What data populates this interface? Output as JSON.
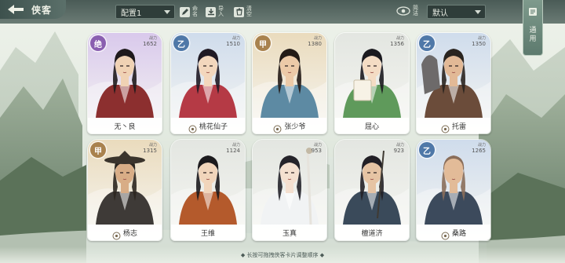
{
  "header": {
    "title": "侠客",
    "preset_value": "配置1",
    "sort_value": "默认",
    "tools": [
      {
        "label": "命名",
        "icon": "pencil-icon"
      },
      {
        "label": "导入",
        "icon": "import-icon"
      },
      {
        "label": "清空",
        "icon": "trash-icon"
      }
    ],
    "view_label": "简洁",
    "side_tab_label": "通用"
  },
  "cards": [
    {
      "name": "无丶良",
      "rank": "绝",
      "power_label": "战力",
      "power": "1652",
      "theme": "purple",
      "badge_color": "#8a5fb0"
    },
    {
      "name": "桃花仙子",
      "rank": "乙",
      "power_label": "战力",
      "power": "1510",
      "theme": "blue",
      "badge_color": "#4f78a8",
      "school_icon": "lotus-icon"
    },
    {
      "name": "张少爷",
      "rank": "甲",
      "power_label": "战力",
      "power": "1380",
      "theme": "gold",
      "badge_color": "#a9824e",
      "school_icon": "sword-icon"
    },
    {
      "name": "屈心",
      "rank": "",
      "power_label": "战力",
      "power": "1356",
      "theme": "grey",
      "badge_color": ""
    },
    {
      "name": "托雷",
      "rank": "乙",
      "power_label": "战力",
      "power": "1350",
      "theme": "blue",
      "badge_color": "#4f78a8",
      "school_icon": "wolf-icon"
    },
    {
      "name": "杨志",
      "rank": "甲",
      "power_label": "战力",
      "power": "1315",
      "theme": "gold",
      "badge_color": "#a9824e",
      "school_icon": "gate-icon"
    },
    {
      "name": "王维",
      "rank": "",
      "power_label": "战力",
      "power": "1124",
      "theme": "grey",
      "badge_color": ""
    },
    {
      "name": "玉真",
      "rank": "",
      "power_label": "战力",
      "power": "953",
      "theme": "grey",
      "badge_color": ""
    },
    {
      "name": "檀道济",
      "rank": "",
      "power_label": "战力",
      "power": "923",
      "theme": "grey",
      "badge_color": ""
    },
    {
      "name": "桑路",
      "rank": "乙",
      "power_label": "战力",
      "power": "1265",
      "theme": "blue",
      "badge_color": "#4f78a8",
      "school_icon": "swirl-icon"
    }
  ],
  "footer": {
    "hint": "◆ 长按可拖拽侠客卡片调整顺序 ◆"
  },
  "colors": {
    "purple": "#d9c9ec",
    "blue": "#cfdcec",
    "gold": "#eadbbd",
    "grey": "#e3e6e1"
  }
}
